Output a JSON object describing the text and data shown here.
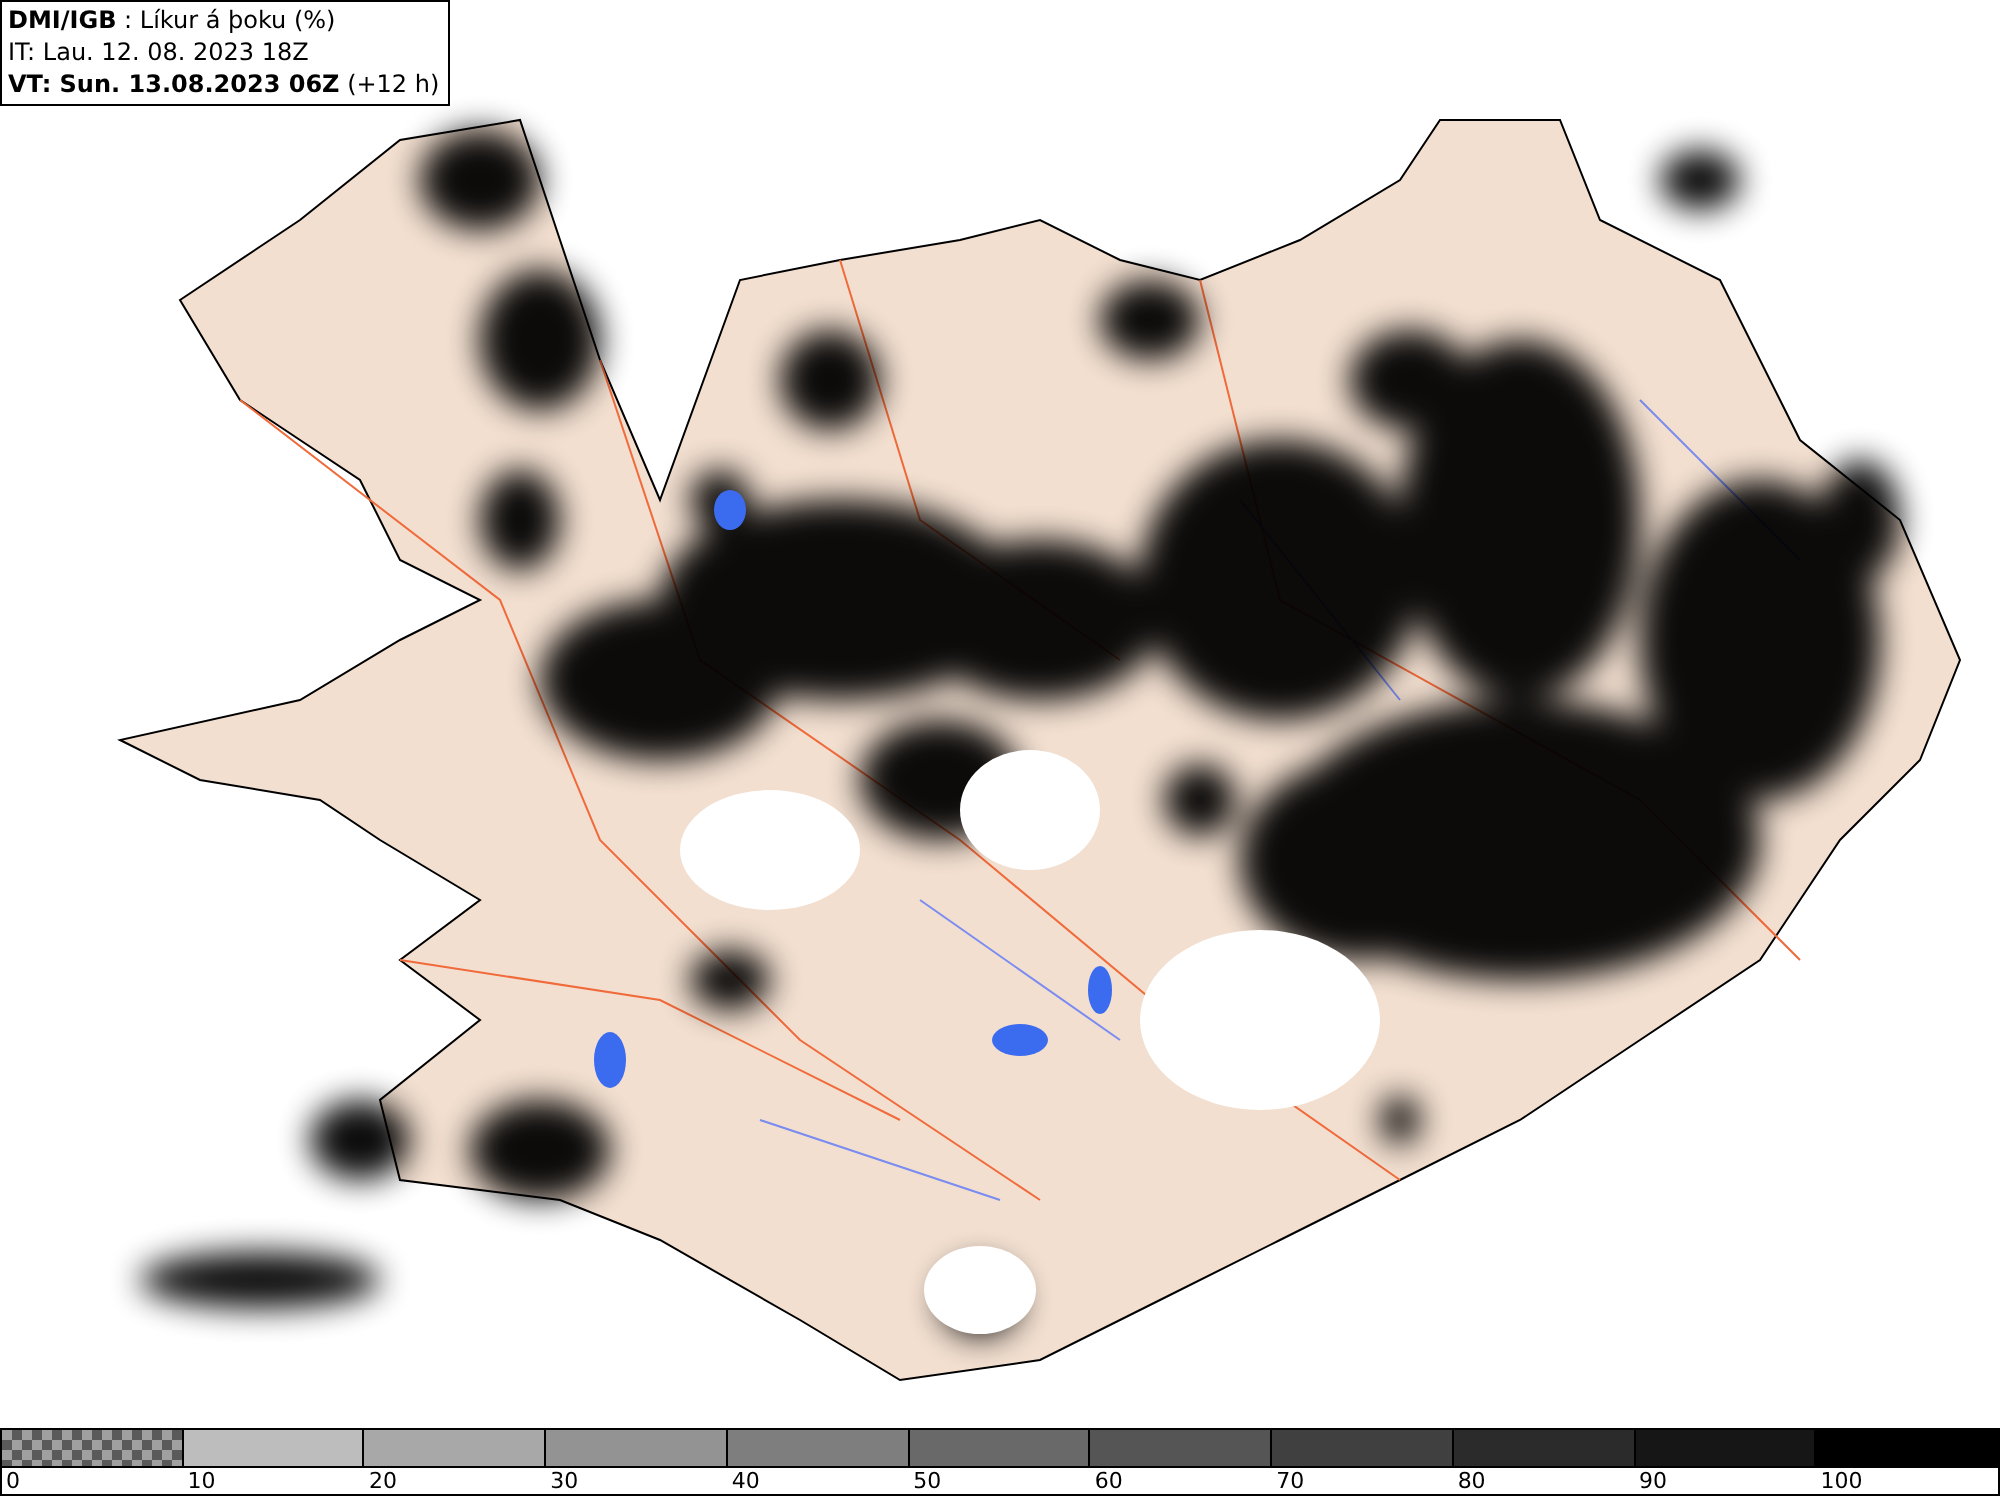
{
  "header": {
    "lines": [
      "**DMI/IGB** : Líkur á þoku (%)",
      "IT: Lau. 12. 08. 2023 18Z",
      "**VT: Sun. 13.08.2023 06Z** (+12 h)"
    ]
  },
  "legend": {
    "segments": [
      {
        "kind": "checker",
        "label": "0"
      },
      {
        "kind": "solid",
        "color": "#bdbdbd",
        "label": "10"
      },
      {
        "kind": "solid",
        "color": "#a8a8a8",
        "label": "20"
      },
      {
        "kind": "solid",
        "color": "#939393",
        "label": "30"
      },
      {
        "kind": "solid",
        "color": "#7e7e7e",
        "label": "40"
      },
      {
        "kind": "solid",
        "color": "#696969",
        "label": "50"
      },
      {
        "kind": "solid",
        "color": "#555555",
        "label": "60"
      },
      {
        "kind": "solid",
        "color": "#404040",
        "label": "70"
      },
      {
        "kind": "solid",
        "color": "#2b2b2b",
        "label": "80"
      },
      {
        "kind": "solid",
        "color": "#161616",
        "label": "90"
      },
      {
        "kind": "solid",
        "color": "#000000",
        "label": "100"
      }
    ]
  }
}
